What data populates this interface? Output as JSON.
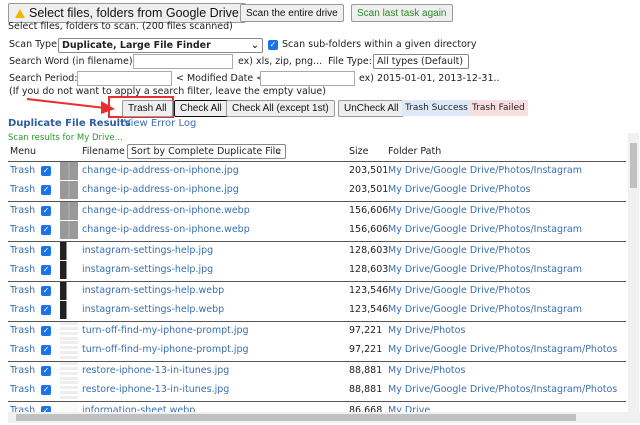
{
  "toolbar": {
    "select_label": "Select files, folders from Google Drive",
    "scan_entire": "Scan the entire drive",
    "scan_last": "Scan last task again"
  },
  "status": "Select files, folders to scan. (200 files scanned)",
  "form": {
    "scan_type_label": "Scan Type",
    "scan_type_value": "Duplicate, Large File Finder",
    "subfolders_label": "Scan sub-folders within a given directory",
    "subfolders_checked": true,
    "search_word_label": "Search Word (in filename):",
    "search_word_value": "",
    "search_word_hint": "ex) xls, zip, png...",
    "file_type_label": "File Type:",
    "file_type_value": "All types (Default)",
    "period_label": "Search Period:",
    "period_from": "",
    "modified_label": "< Modified Date <",
    "period_to": "",
    "period_hint": "ex) 2015-01-01, 2013-12-31..",
    "note": "(If you do not want to apply a search filter, leave the empty value)"
  },
  "actions": {
    "trash_all": "Trash All",
    "check_all": "Check All",
    "check_all_except": "Check All (except 1st)",
    "uncheck_all": "UnCheck All",
    "trash_success": "Trash Success",
    "trash_failed": "Trash Failed"
  },
  "results": {
    "title": "Duplicate File Results",
    "error_log": "View Error Log",
    "scan_note": "Scan results for My Drive...",
    "headers": {
      "menu": "Menu",
      "filename": "Filename",
      "sort_value": "Sort by Complete Duplicate File",
      "size": "Size",
      "path": "Folder Path"
    },
    "rows": [
      {
        "action": "Trash",
        "name": "change-ip-address-on-iphone.jpg",
        "size": "203,501",
        "path": "My Drive/Google Drive/Photos/Instagram",
        "thumb": "gray"
      },
      {
        "action": "Trash",
        "name": "change-ip-address-on-iphone.jpg",
        "size": "203,501",
        "path": "My Drive/Google Drive/Photos",
        "thumb": "gray"
      },
      {
        "action": "Trash",
        "name": "change-ip-address-on-iphone.webp",
        "size": "156,606",
        "path": "My Drive/Google Drive/Photos",
        "thumb": "gray"
      },
      {
        "action": "Trash",
        "name": "change-ip-address-on-iphone.webp",
        "size": "156,606",
        "path": "My Drive/Google Drive/Photos/Instagram",
        "thumb": "gray"
      },
      {
        "action": "Trash",
        "name": "instagram-settings-help.jpg",
        "size": "128,603",
        "path": "My Drive/Google Drive/Photos",
        "thumb": "dark"
      },
      {
        "action": "Trash",
        "name": "instagram-settings-help.jpg",
        "size": "128,603",
        "path": "My Drive/Google Drive/Photos/Instagram",
        "thumb": "dark"
      },
      {
        "action": "Trash",
        "name": "instagram-settings-help.webp",
        "size": "123,546",
        "path": "My Drive/Google Drive/Photos",
        "thumb": "dark"
      },
      {
        "action": "Trash",
        "name": "instagram-settings-help.webp",
        "size": "123,546",
        "path": "My Drive/Google Drive/Photos/Instagram",
        "thumb": "dark"
      },
      {
        "action": "Trash",
        "name": "turn-off-find-my-iphone-prompt.jpg",
        "size": "97,221",
        "path": "My Drive/Photos",
        "thumb": "light"
      },
      {
        "action": "Trash",
        "name": "turn-off-find-my-iphone-prompt.jpg",
        "size": "97,221",
        "path": "My Drive/Google Drive/Photos/Instagram/Photos",
        "thumb": "light"
      },
      {
        "action": "Trash",
        "name": "restore-iphone-13-in-itunes.jpg",
        "size": "88,881",
        "path": "My Drive/Photos",
        "thumb": "light"
      },
      {
        "action": "Trash",
        "name": "restore-iphone-13-in-itunes.jpg",
        "size": "88,881",
        "path": "My Drive/Google Drive/Photos/Instagram/Photos",
        "thumb": "light"
      },
      {
        "action": "Trash",
        "name": "information-sheet.webp",
        "size": "86,668",
        "path": "My Drive",
        "thumb": "blank"
      }
    ]
  }
}
